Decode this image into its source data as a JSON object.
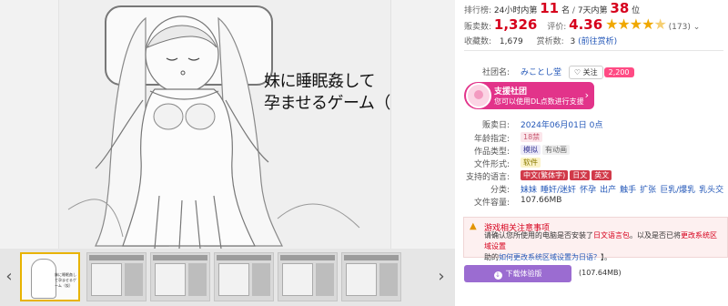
{
  "gallery": {
    "title_line1": "妹に睡眠姦して",
    "title_line2": "孕ませるゲーム（仮）",
    "prev_arrow": "‹",
    "next_arrow": "›",
    "thumb_caption": "妹に睡眠姦して孕ませるゲーム（仮）",
    "thumbs": [
      {
        "active": true
      },
      {
        "active": false
      },
      {
        "active": false
      },
      {
        "active": false
      },
      {
        "active": false
      },
      {
        "active": false
      }
    ]
  },
  "ranking": {
    "label": "排行榜:",
    "period_24h": "24小时内第",
    "rank_24h": "11",
    "unit_24h": "名",
    "sep": "/",
    "period_7d": "7天内第",
    "rank_7d": "38",
    "unit_7d": "位"
  },
  "sales": {
    "label": "贩卖数:",
    "value": "1,326",
    "rating_label": "评价:",
    "rating": "4.36",
    "rating_value": 4.36,
    "stars": "★★★★",
    "half_star": "★",
    "review_count": "(173)",
    "dropdown_icon": "chevron-down-icon"
  },
  "favorites": {
    "label": "收藏数:",
    "value": "1,679",
    "appraise_label": "赏析数:",
    "appraise_value": "3",
    "appraise_link": "(前往赏析)"
  },
  "circle": {
    "label": "社团名:",
    "name": "みことし堂",
    "follow": "关注",
    "follower_count": "2,200"
  },
  "support_banner": {
    "title": "支援社团",
    "subtitle": "您可以使用DL点数进行支援",
    "chevron": "›"
  },
  "details": {
    "release_label": "贩卖日:",
    "release_value": "2024年06月01日 0点",
    "age_label": "年龄指定:",
    "age_value": "18禁",
    "type_label": "作品类型:",
    "type_values": [
      "模拟",
      "有动画"
    ],
    "format_label": "文件形式:",
    "format_value": "软件",
    "lang_label": "支持的语言:",
    "lang_values": [
      "中文(繁体字)",
      "日文",
      "英文"
    ],
    "genre_label": "分类:",
    "genres": [
      "妹妹",
      "睡奸/迷奸",
      "怀孕",
      "出产",
      "触手",
      "扩张",
      "巨乳/爆乳",
      "乳头交"
    ],
    "size_label": "文件容量:",
    "size_value": "107.66MB"
  },
  "notice": {
    "title": "游戏相关注意事项",
    "body_1": "请确认您所使用的电脑是否安装了",
    "link_1": "日文语言包",
    "body_2": "。以及是否已将",
    "link_2": "更改系统区域设置",
    "body_3": "助的",
    "link_3": "如何更改系统区域设置为日语？",
    "body_4": "】。"
  },
  "download": {
    "label": "下载体验版",
    "size": "(107.64MB)"
  },
  "colors": {
    "accent_red": "#d6001c",
    "star": "#f0a800",
    "support_pink": "#e2338a",
    "download_purple": "#9b6cd1"
  }
}
